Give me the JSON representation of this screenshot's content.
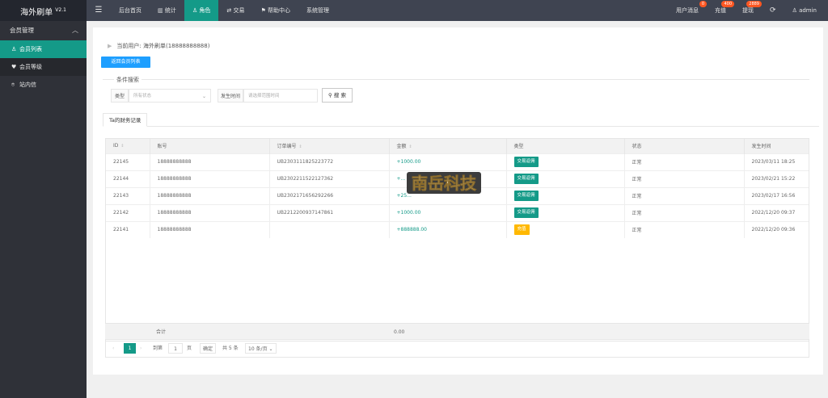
{
  "app": {
    "name": "海外刷单",
    "version": "V2.1"
  },
  "topnav": {
    "items": [
      "后台首页",
      "统计",
      "角色",
      "交易",
      "帮助中心",
      "系统管理"
    ],
    "active": 2,
    "right": [
      {
        "label": "用户消息",
        "badge": "0"
      },
      {
        "label": "充值",
        "badge": "400"
      },
      {
        "label": "提现",
        "badge": "2889"
      }
    ],
    "user": "admin"
  },
  "sidebar": {
    "group": "会员管理",
    "items": [
      "会员列表",
      "会员等级"
    ],
    "extra": "站内信"
  },
  "breadcrumb": "当前用户: 海外刷单(18888888888)",
  "back_button": "返回会员列表",
  "search": {
    "legend": "条件搜索",
    "type_label": "类型",
    "type_value": "所有状态",
    "time_label": "发生时间",
    "time_placeholder": "请选择范围时间",
    "button": "搜 索"
  },
  "tab": "Ta的财务记录",
  "table": {
    "columns": [
      "ID",
      "账号",
      "订单编号",
      "金额",
      "类型",
      "状态",
      "发生时间"
    ],
    "rows": [
      {
        "id": "22145",
        "account": "18888888888",
        "order": "UB2303111825223772",
        "amount": "+1000.00",
        "type": "交易返佣",
        "status": "正常",
        "time": "2023/03/11 18:25"
      },
      {
        "id": "22144",
        "account": "18888888888",
        "order": "UB2302211522127362",
        "amount": "+...",
        "type": "交易返佣",
        "status": "正常",
        "time": "2023/02/21 15:22"
      },
      {
        "id": "22143",
        "account": "18888888888",
        "order": "UB2302171656292266",
        "amount": "+25...",
        "type": "交易返佣",
        "status": "正常",
        "time": "2023/02/17 16:56"
      },
      {
        "id": "22142",
        "account": "18888888888",
        "order": "UB2212200937147861",
        "amount": "+1000.00",
        "type": "交易返佣",
        "status": "正常",
        "time": "2022/12/20 09:37"
      },
      {
        "id": "22141",
        "account": "18888888888",
        "order": "",
        "amount": "+888888.00",
        "type": "充值",
        "status": "正常",
        "time": "2022/12/20 09:36"
      }
    ],
    "total_label": "合计",
    "total_value": "0.00"
  },
  "pager": {
    "current": "1",
    "goto_label": "到第",
    "goto_value": "1",
    "page_unit": "页",
    "confirm": "确定",
    "count": "共 5 条",
    "per_page": "10 条/页"
  },
  "watermark": "南岳科技",
  "colors": {
    "accent": "#149a88",
    "primary": "#1e9fff",
    "warning": "#ffb800",
    "badge": "#ff5722"
  }
}
